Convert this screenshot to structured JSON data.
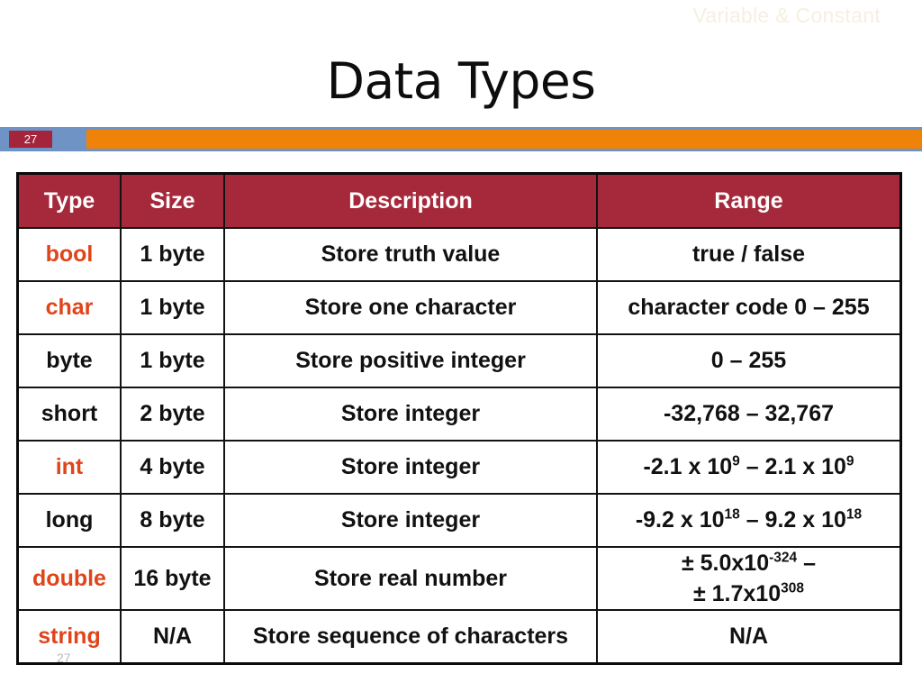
{
  "watermark": "Variable & Constant",
  "title": "Data Types",
  "band": {
    "page_badge": "27",
    "orange_color": "#ef8208",
    "badge_color": "#a3243b",
    "border_color": "#6f93c4"
  },
  "footer": {
    "stray_page_number": "27"
  },
  "colors": {
    "header_red": "#a5293a",
    "accent_orange": "#e0441a",
    "text_black": "#111111",
    "watermark": "#f6efe2"
  },
  "table": {
    "headers": [
      "Type",
      "Size",
      "Description",
      "Range"
    ],
    "rows": [
      {
        "type": "bool",
        "accent": true,
        "size": "1 byte",
        "description": "Store truth value",
        "range": "true / false"
      },
      {
        "type": "char",
        "accent": true,
        "size": "1 byte",
        "description": "Store one character",
        "range": "character code 0 – 255"
      },
      {
        "type": "byte",
        "accent": false,
        "size": "1 byte",
        "description": "Store positive integer",
        "range": "0 – 255"
      },
      {
        "type": "short",
        "accent": false,
        "size": "2 byte",
        "description": "Store integer",
        "range": "-32,768 – 32,767"
      },
      {
        "type": "int",
        "accent": true,
        "size": "4 byte",
        "description": "Store integer",
        "range_parts": {
          "a": "-2.1 x 10",
          "a_sup": "9",
          "b": " – 2.1 x 10",
          "b_sup": "9"
        }
      },
      {
        "type": "long",
        "accent": false,
        "size": "8 byte",
        "description": "Store integer",
        "range_parts": {
          "a": "-9.2 x 10",
          "a_sup": "18",
          "b": " – 9.2 x 10",
          "b_sup": "18"
        }
      },
      {
        "type": "double",
        "accent": true,
        "size": "16 byte",
        "description": "Store real number",
        "range_parts": {
          "line1": "± 5.0x10",
          "line1_sup": "-324",
          "line1_tail": " –",
          "line2": "± 1.7x10",
          "line2_sup": "308"
        }
      },
      {
        "type": "string",
        "accent": true,
        "size": "N/A",
        "description": "Store sequence of characters",
        "range": "N/A"
      }
    ]
  }
}
